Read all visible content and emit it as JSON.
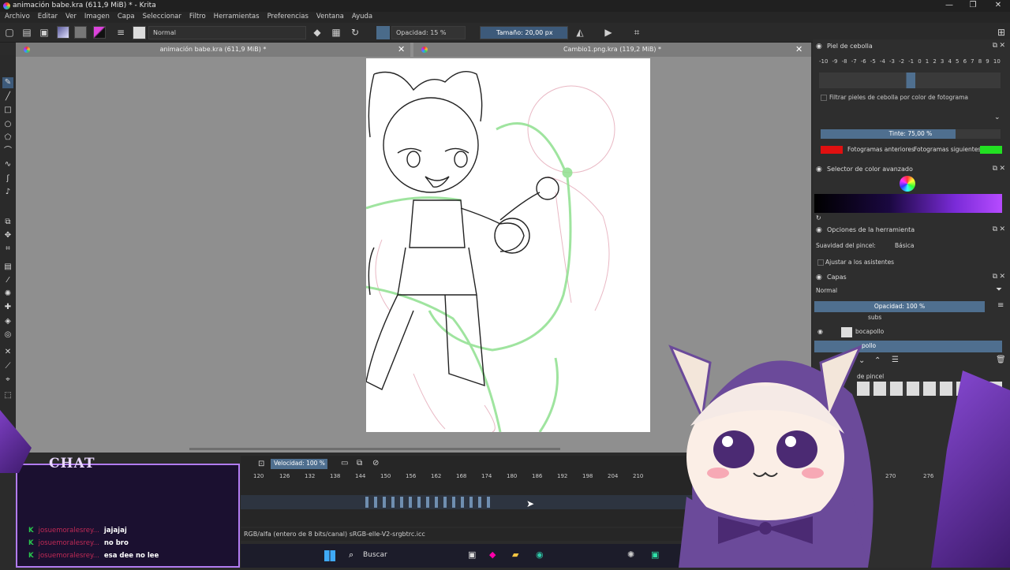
{
  "window": {
    "title": "animación babe.kra (611,9 MiB) * - Krita",
    "controls": [
      "—",
      "❐",
      "✕"
    ]
  },
  "menu": [
    "Archivo",
    "Editar",
    "Ver",
    "Imagen",
    "Capa",
    "Seleccionar",
    "Filtro",
    "Herramientas",
    "Preferencias",
    "Ventana",
    "Ayuda"
  ],
  "toolbar": {
    "blend_mode": "Normal",
    "opacity": "Opacidad: 15 %",
    "size": "Tamaño: 20,00 px"
  },
  "documents": {
    "tab1": "animación babe.kra (611,9 MiB) *",
    "tab2": "Cambio1.png.kra (119,2 MiB) *"
  },
  "onion": {
    "title": "Piel de cebolla",
    "scale": [
      "-10",
      "-9",
      "-8",
      "-7",
      "-6",
      "-5",
      "-4",
      "-3",
      "-2",
      "-1",
      "0",
      "1",
      "2",
      "3",
      "4",
      "5",
      "6",
      "7",
      "8",
      "9",
      "10"
    ],
    "filter_label": "Filtrar pieles de cebolla por color de fotograma",
    "tint": "Tinte: 75,00 %",
    "prev_label": "Fotogramas anteriores",
    "next_label": "Fotogramas siguientes",
    "prev_color": "#e01010",
    "next_color": "#22e022"
  },
  "color_selector": {
    "title": "Selector de color avanzado"
  },
  "tool_options": {
    "title": "Opciones de la herramienta",
    "smoothing_label": "Suavidad del pincel:",
    "smoothing_value": "Básica",
    "assistants_label": "Ajustar a los asistentes"
  },
  "layers": {
    "title": "Capas",
    "blend": "Normal",
    "opacity": "Opacidad: 100 %",
    "items": [
      "subs",
      "bocapollo",
      "pollo"
    ]
  },
  "presets": {
    "title": "de pincel"
  },
  "timeline": {
    "speed": "Velocidad: 100 %",
    "ticks": [
      "120",
      "126",
      "132",
      "138",
      "144",
      "150",
      "156",
      "162",
      "168",
      "174",
      "180",
      "186",
      "192",
      "198",
      "204",
      "210",
      "270",
      "276"
    ]
  },
  "status": {
    "color_profile": "RGB/alfa (entero de 8 bits/canal)  sRGB-elle-V2-srgbtrc.icc"
  },
  "taskbar": {
    "search": "Buscar"
  },
  "chat": {
    "title": "CHAT",
    "messages": [
      {
        "user": "josuemoralesrey...",
        "text": "jajajaj"
      },
      {
        "user": "josuemoralesrey...",
        "text": "no bro"
      },
      {
        "user": "josuemoralesrey...",
        "text": "esa dee no lee"
      }
    ]
  }
}
